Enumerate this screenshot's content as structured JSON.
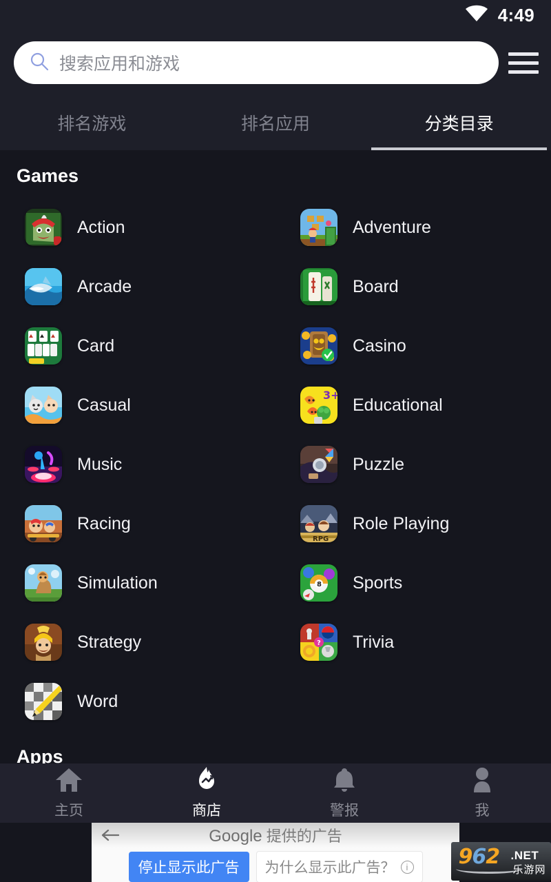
{
  "statusbar": {
    "time": "4:49",
    "wifi_icon": "wifi-icon"
  },
  "search": {
    "placeholder": "搜索应用和游戏",
    "value": "",
    "icon": "search-icon"
  },
  "menu": {
    "icon": "hamburger-menu-icon"
  },
  "tabs": [
    {
      "label": "排名游戏",
      "active": false
    },
    {
      "label": "排名应用",
      "active": false
    },
    {
      "label": "分类目录",
      "active": true
    }
  ],
  "sections": [
    {
      "title": "Games"
    },
    {
      "title": "Apps"
    }
  ],
  "categories": [
    {
      "label": "Action",
      "icon": "action-zombie-icon"
    },
    {
      "label": "Adventure",
      "icon": "adventure-platformer-icon"
    },
    {
      "label": "Arcade",
      "icon": "arcade-shark-icon"
    },
    {
      "label": "Board",
      "icon": "board-mahjong-icon"
    },
    {
      "label": "Card",
      "icon": "card-solitaire-icon"
    },
    {
      "label": "Casino",
      "icon": "casino-slots-icon"
    },
    {
      "label": "Casual",
      "icon": "casual-cats-icon"
    },
    {
      "label": "Educational",
      "icon": "educational-veggies-icon"
    },
    {
      "label": "Music",
      "icon": "music-drums-icon"
    },
    {
      "label": "Puzzle",
      "icon": "puzzle-icon"
    },
    {
      "label": "Racing",
      "icon": "racing-kart-icon"
    },
    {
      "label": "Role Playing",
      "icon": "role-playing-icon"
    },
    {
      "label": "Simulation",
      "icon": "simulation-icon"
    },
    {
      "label": "Sports",
      "icon": "sports-8ball-icon"
    },
    {
      "label": "Strategy",
      "icon": "strategy-barbarian-icon"
    },
    {
      "label": "Trivia",
      "icon": "trivia-logoquiz-icon"
    },
    {
      "label": "Word",
      "icon": "word-crossword-icon"
    }
  ],
  "bottomnav": [
    {
      "label": "主页",
      "icon": "home-icon",
      "active": false
    },
    {
      "label": "商店",
      "icon": "flame-store-icon",
      "active": true
    },
    {
      "label": "警报",
      "icon": "bell-icon",
      "active": false
    },
    {
      "label": "我",
      "icon": "person-icon",
      "active": false
    }
  ],
  "ad": {
    "back_icon": "back-arrow-icon",
    "brand": "Google",
    "title_suffix": " 提供的广告",
    "stop_button": "停止显示此广告",
    "why_button": "为什么显示此广告？",
    "info_icon": "info-icon"
  },
  "watermark": {
    "num": "962",
    "net": ".NET",
    "cn": "乐游网"
  },
  "colors": {
    "background": "#15161e",
    "header": "#1e1f29",
    "navbar": "#22222e",
    "accent_blue": "#4285f4",
    "tab_inactive": "#80828d",
    "tab_active": "#ffffff"
  }
}
